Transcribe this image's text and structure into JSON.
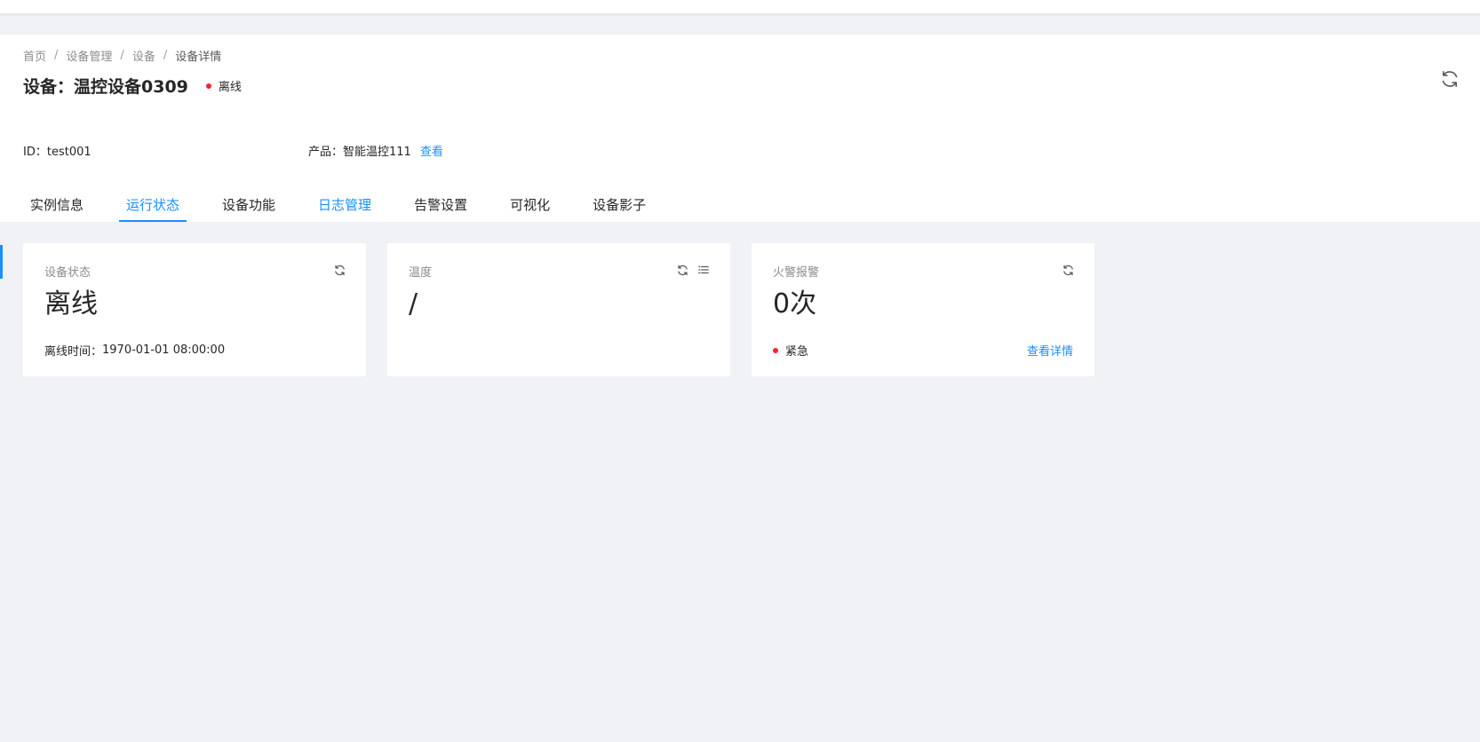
{
  "breadcrumb": {
    "items": [
      "首页",
      "设备管理",
      "设备",
      "设备详情"
    ],
    "separator": "/"
  },
  "header": {
    "title_prefix": "设备：",
    "device_name": "温控设备0309",
    "status": "离线",
    "status_color": "#f5222d"
  },
  "meta": {
    "id_label": "ID：",
    "id_value": "test001",
    "product_label": "产品：",
    "product_value": "智能温控111",
    "product_link": "查看"
  },
  "tabs": [
    {
      "label": "实例信息"
    },
    {
      "label": "运行状态"
    },
    {
      "label": "设备功能"
    },
    {
      "label": "日志管理"
    },
    {
      "label": "告警设置"
    },
    {
      "label": "可视化"
    },
    {
      "label": "设备影子"
    }
  ],
  "cards": {
    "device_status": {
      "label": "设备状态",
      "value": "离线",
      "footer_label": "离线时间：",
      "footer_value": "1970-01-01 08:00:00"
    },
    "temperature": {
      "label": "温度",
      "value": "/"
    },
    "fire_alarm": {
      "label": "火警报警",
      "value": "0次",
      "level": "紧急",
      "level_color": "#f5222d",
      "detail_link": "查看详情"
    }
  },
  "icons": {
    "refresh": "refresh-icon",
    "list": "list-icon"
  },
  "colors": {
    "accent": "#1890ff",
    "danger": "#f5222d",
    "background": "#f0f2f5"
  }
}
